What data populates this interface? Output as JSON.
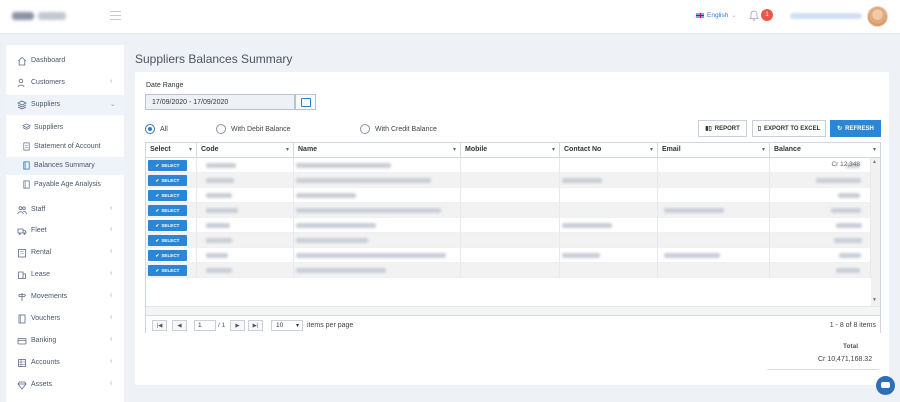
{
  "header": {
    "language": "English",
    "notification_count": "1"
  },
  "sidebar": {
    "items": [
      {
        "label": "Dashboard",
        "icon": "home-icon",
        "chevron": ""
      },
      {
        "label": "Customers",
        "icon": "users-icon",
        "chevron": "‹"
      },
      {
        "label": "Suppliers",
        "icon": "layers-icon",
        "chevron": "⌄"
      },
      {
        "label": "Staff",
        "icon": "staff-icon",
        "chevron": "‹"
      },
      {
        "label": "Fleet",
        "icon": "truck-icon",
        "chevron": "‹"
      },
      {
        "label": "Rental",
        "icon": "building-icon",
        "chevron": "‹"
      },
      {
        "label": "Lease",
        "icon": "lease-icon",
        "chevron": "‹"
      },
      {
        "label": "Movements",
        "icon": "signpost-icon",
        "chevron": "‹"
      },
      {
        "label": "Vouchers",
        "icon": "voucher-icon",
        "chevron": "‹"
      },
      {
        "label": "Banking",
        "icon": "card-icon",
        "chevron": "‹"
      },
      {
        "label": "Accounts",
        "icon": "accounts-icon",
        "chevron": "‹"
      },
      {
        "label": "Assets",
        "icon": "diamond-icon",
        "chevron": "‹"
      }
    ],
    "suppliers_sub": [
      {
        "label": "Suppliers"
      },
      {
        "label": "Statement of Account"
      },
      {
        "label": "Balances Summary"
      },
      {
        "label": "Payable Age Analysis"
      }
    ]
  },
  "main": {
    "title": "Suppliers Balances Summary",
    "date_range_label": "Date Range",
    "date_range_value": "17/09/2020 - 17/09/2020",
    "filters": [
      {
        "label": "All",
        "selected": true
      },
      {
        "label": "With Debit Balance",
        "selected": false
      },
      {
        "label": "With Credit Balance",
        "selected": false
      }
    ],
    "buttons": {
      "report": "REPORT",
      "export": "EXPORT TO EXCEL",
      "refresh": "REFRESH"
    },
    "grid": {
      "columns": [
        "Select",
        "Code",
        "Name",
        "Mobile",
        "Contact No",
        "Email",
        "Balance"
      ],
      "select_label": "SELECT",
      "first_row_balance_partial": "Cr 12,348",
      "row_count": 8
    },
    "pager": {
      "page": "1",
      "of": "/ 1",
      "page_size": "10",
      "per_page_label": "items per page",
      "info": "1 - 8 of 8 items"
    },
    "total": {
      "label": "Total",
      "value": "Cr 10,471,168.32"
    }
  },
  "colors": {
    "accent": "#2c86d6",
    "notification": "#e8574b"
  }
}
